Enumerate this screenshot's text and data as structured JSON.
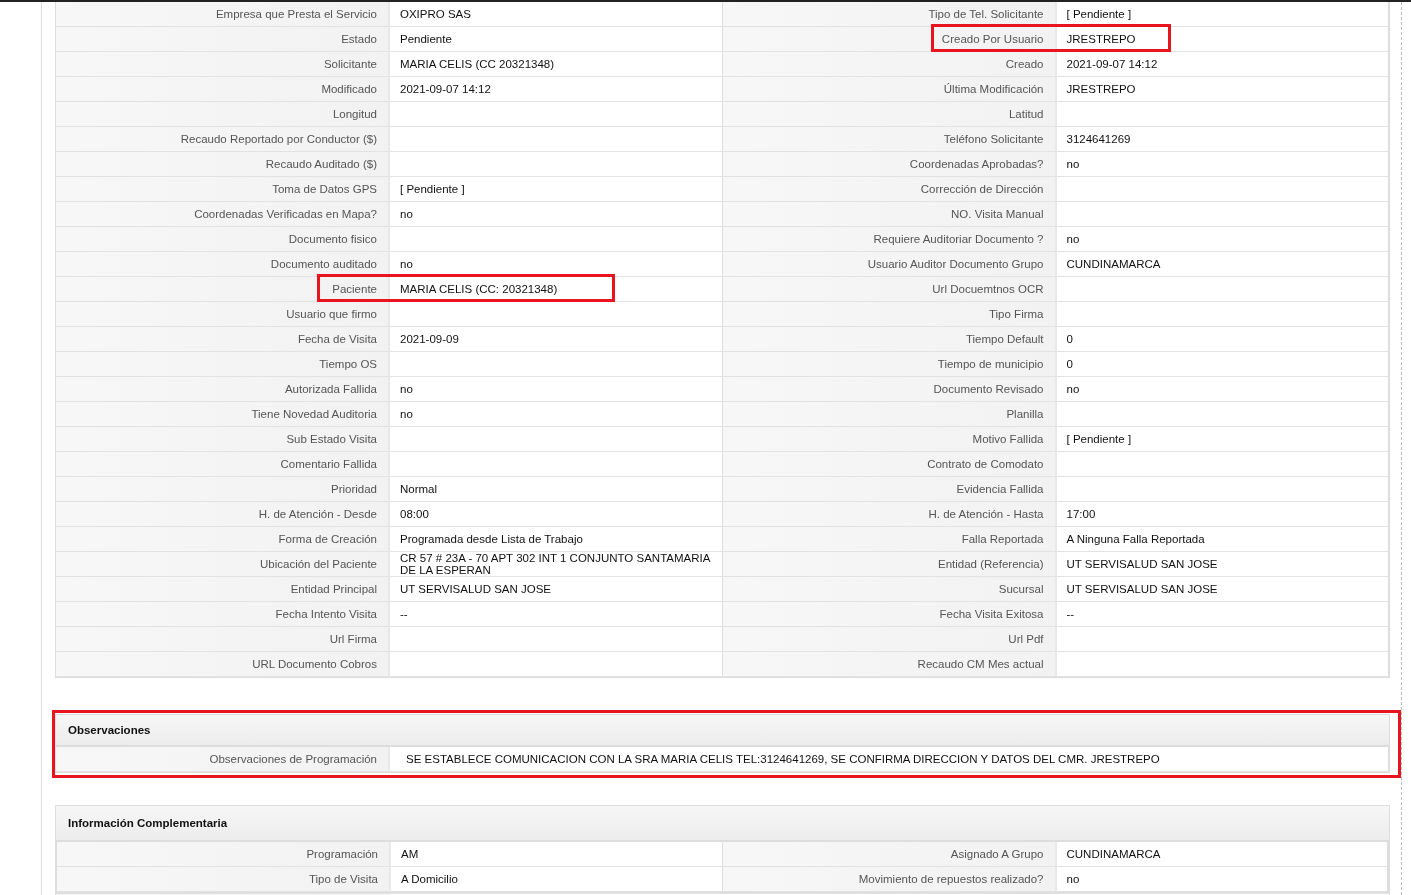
{
  "details": {
    "rows": [
      {
        "left": {
          "label": "Empresa que Presta el Servicio",
          "value": "OXIPRO SAS"
        },
        "right": {
          "label": "Tipo de Tel. Solicitante",
          "value": "[ Pendiente ]"
        }
      },
      {
        "left": {
          "label": "Estado",
          "value": "Pendiente"
        },
        "right": {
          "label": "Creado Por Usuario",
          "value": "JRESTREPO",
          "highlighted": true
        }
      },
      {
        "left": {
          "label": "Solicitante",
          "value": "MARIA CELIS (CC 20321348)"
        },
        "right": {
          "label": "Creado",
          "value": "2021-09-07 14:12"
        }
      },
      {
        "left": {
          "label": "Modificado",
          "value": "2021-09-07 14:12"
        },
        "right": {
          "label": "Última Modificación",
          "value": "JRESTREPO"
        }
      },
      {
        "left": {
          "label": "Longitud"
        },
        "right": {
          "label": "Latitud"
        }
      },
      {
        "left": {
          "label": "Recaudo Reportado por Conductor ($)"
        },
        "right": {
          "label": "Teléfono Solicitante",
          "value": "3124641269"
        }
      },
      {
        "left": {
          "label": "Recaudo Auditado ($)"
        },
        "right": {
          "label": "Coordenadas Aprobadas?",
          "value": "no"
        }
      },
      {
        "left": {
          "label": "Toma de Datos GPS",
          "value": "[ Pendiente ]"
        },
        "right": {
          "label": "Corrección de Dirección"
        }
      },
      {
        "left": {
          "label": "Coordenadas Verificadas en Mapa?",
          "value": "no"
        },
        "right": {
          "label": "NO. Visita Manual"
        }
      },
      {
        "left": {
          "label": "Documento fisico"
        },
        "right": {
          "label": "Requiere Auditoriar Documento ?",
          "value": "no"
        }
      },
      {
        "left": {
          "label": "Documento auditado",
          "value": "no"
        },
        "right": {
          "label": "Usuario Auditor Documento Grupo",
          "value": "CUNDINAMARCA"
        }
      },
      {
        "left": {
          "label": "Paciente",
          "value": "MARIA CELIS (CC: 20321348)",
          "highlighted": true
        },
        "right": {
          "label": "Url Docuemtnos OCR"
        }
      },
      {
        "left": {
          "label": "Usuario que firmo"
        },
        "right": {
          "label": "Tipo Firma"
        }
      },
      {
        "left": {
          "label": "Fecha de Visita",
          "value": "2021-09-09"
        },
        "right": {
          "label": "Tiempo Default",
          "value": "0"
        }
      },
      {
        "left": {
          "label": "Tiempo OS"
        },
        "right": {
          "label": "Tiempo de municipio",
          "value": "0"
        }
      },
      {
        "left": {
          "label": "Autorizada Fallida",
          "value": "no"
        },
        "right": {
          "label": "Documento Revisado",
          "value": "no"
        }
      },
      {
        "left": {
          "label": "Tiene Novedad Auditoria",
          "value": "no"
        },
        "right": {
          "label": "Planilla"
        }
      },
      {
        "left": {
          "label": "Sub Estado Visita"
        },
        "right": {
          "label": "Motivo Fallida",
          "value": "[ Pendiente ]"
        }
      },
      {
        "left": {
          "label": "Comentario Fallida"
        },
        "right": {
          "label": "Contrato de Comodato"
        }
      },
      {
        "left": {
          "label": "Prioridad",
          "value": "Normal"
        },
        "right": {
          "label": "Evidencia Fallida"
        }
      },
      {
        "left": {
          "label": "H. de Atención - Desde",
          "value": "08:00"
        },
        "right": {
          "label": "H. de Atención - Hasta",
          "value": "17:00"
        }
      },
      {
        "left": {
          "label": "Forma de Creación",
          "value": "Programada desde Lista de Trabajo"
        },
        "right": {
          "label": "Falla Reportada",
          "value": "A Ninguna Falla Reportada"
        }
      },
      {
        "left": {
          "label": "Ubicación del Paciente",
          "value": "CR 57 # 23A - 70 APT 302 INT 1 CONJUNTO SANTAMARIA DE LA ESPERAN"
        },
        "right": {
          "label": "Entidad (Referencia)",
          "value": "UT SERVISALUD SAN JOSE"
        }
      },
      {
        "left": {
          "label": "Entidad Principal",
          "value": "UT SERVISALUD SAN JOSE"
        },
        "right": {
          "label": "Sucursal",
          "value": "UT SERVISALUD SAN JOSE"
        }
      },
      {
        "left": {
          "label": "Fecha Intento Visita",
          "value": "--"
        },
        "right": {
          "label": "Fecha Visita Exitosa",
          "value": "--"
        }
      },
      {
        "left": {
          "label": "Url Firma"
        },
        "right": {
          "label": "Url Pdf"
        }
      },
      {
        "left": {
          "label": "URL Documento Cobros"
        },
        "right": {
          "label": "Recaudo CM Mes actual"
        }
      }
    ]
  },
  "observations": {
    "title": "Observaciones",
    "highlighted": true,
    "label": "Observaciones de Programación",
    "value": "SE ESTABLECE COMUNICACION CON LA SRA MARIA CELIS TEL:3124641269, SE CONFIRMA DIRECCION Y DATOS DEL CMR. JRESTREPO"
  },
  "complementary": {
    "title": "Información Complementaria",
    "rows": [
      {
        "left": {
          "label": "Programación",
          "value": "AM"
        },
        "right": {
          "label": "Asignado A Grupo",
          "value": "CUNDINAMARCA"
        }
      },
      {
        "left": {
          "label": "Tipo de Visita",
          "value": "A Domicilio"
        },
        "right": {
          "label": "Movimiento de repuestos realizado?",
          "value": "no"
        }
      }
    ]
  }
}
